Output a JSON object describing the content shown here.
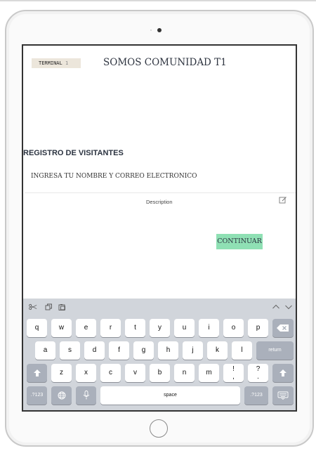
{
  "app": {
    "terminal_tag": "TERMINAL",
    "terminal_number": "1",
    "title": "SOMOS COMUNIDAD T1"
  },
  "form": {
    "section_title": "REGISTRO DE VISITANTES",
    "name_prompt": "INGRESA TU NOMBRE  Y CORREO ELECTRONICO",
    "description_label": "Description",
    "continue_label": "CONTINUAR"
  },
  "colors": {
    "continue_button": "#8fe0b4",
    "terminal_tag_bg": "#ece6db",
    "keyboard_bg": "#d1d5db"
  },
  "keyboard": {
    "toolbar_icons": [
      "scissors-icon",
      "copy-icon",
      "paste-icon",
      "chevron-up-icon",
      "chevron-down-icon"
    ],
    "row1": [
      "q",
      "w",
      "e",
      "r",
      "t",
      "y",
      "u",
      "i",
      "o",
      "p"
    ],
    "row2": [
      "a",
      "s",
      "d",
      "f",
      "g",
      "h",
      "j",
      "k",
      "l"
    ],
    "row3": [
      "z",
      "x",
      "c",
      "v",
      "b",
      "n",
      "m"
    ],
    "punct1_top": "!",
    "punct1_bottom": ",",
    "punct2_top": "?",
    "punct2_bottom": ".",
    "return_label": "return",
    "numbers_label": ".?123",
    "space_label": "space"
  }
}
